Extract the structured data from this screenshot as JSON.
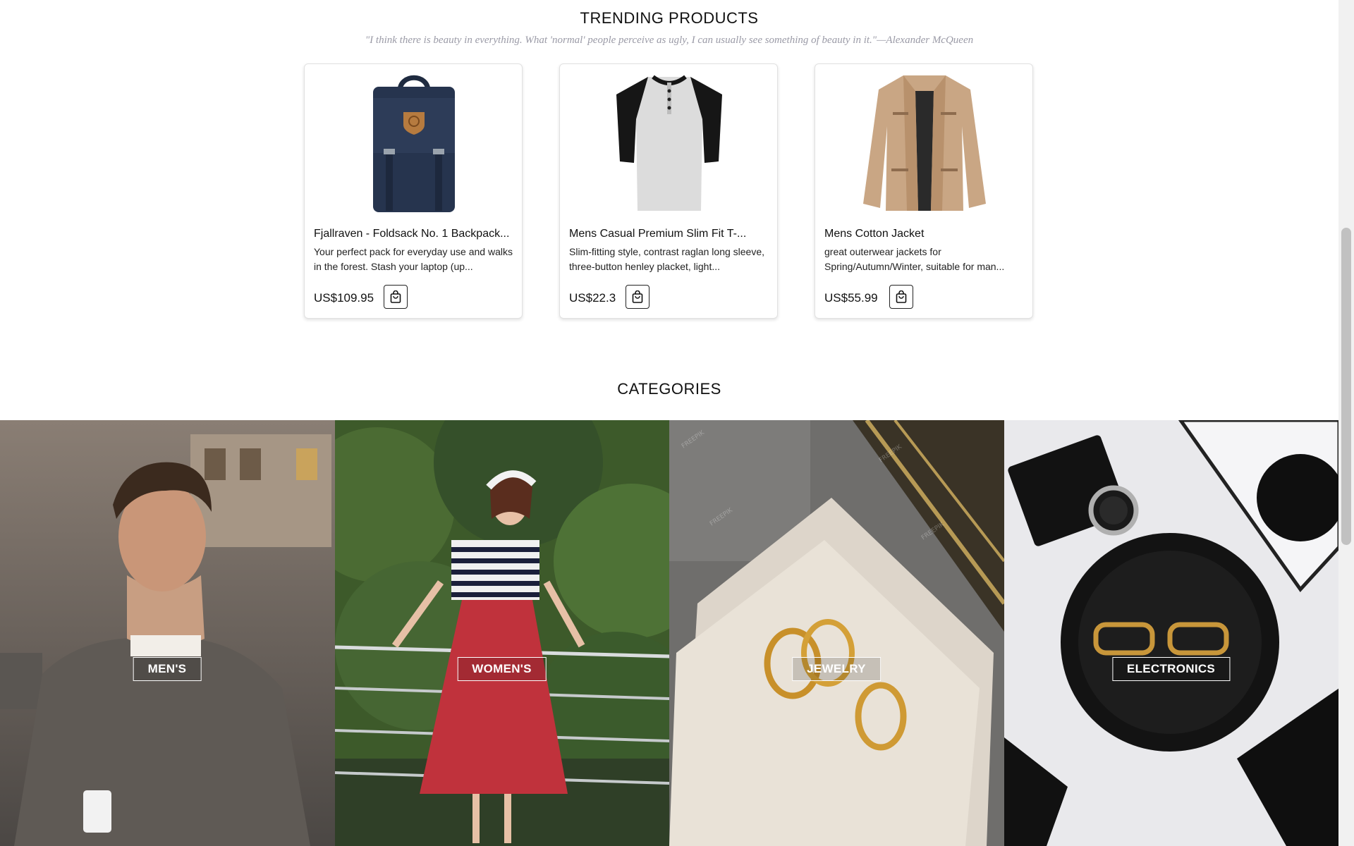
{
  "trending": {
    "title": "TRENDING PRODUCTS",
    "quote": "\"I think there is beauty in everything. What 'normal' people perceive as ugly, I can usually see something of beauty in it.\"—Alexander McQueen",
    "products": [
      {
        "name": "Fjallraven - Foldsack No. 1 Backpack...",
        "description": "Your perfect pack for everyday use and walks in the forest. Stash your laptop (up...",
        "price": "US$109.95",
        "image_icon": "backpack-image"
      },
      {
        "name": "Mens Casual Premium Slim Fit T-...",
        "description": "Slim-fitting style, contrast raglan long sleeve, three-button henley placket, light...",
        "price": "US$22.3",
        "image_icon": "tshirt-image"
      },
      {
        "name": "Mens Cotton Jacket",
        "description": "great outerwear jackets for Spring/Autumn/Winter, suitable for man...",
        "price": "US$55.99",
        "image_icon": "jacket-image"
      }
    ],
    "cart_icon": "shopping-bag-icon"
  },
  "categories": {
    "title": "CATEGORIES",
    "items": [
      {
        "label": "MEN'S"
      },
      {
        "label": "WOMEN'S"
      },
      {
        "label": "JEWELRY"
      },
      {
        "label": "ELECTRONICS"
      }
    ]
  },
  "colors": {
    "quote_text": "#9a9aa6",
    "card_border": "#e1e1e1",
    "backpack": "#24324a",
    "jacket": "#c8a582",
    "skirt": "#c0323c"
  }
}
